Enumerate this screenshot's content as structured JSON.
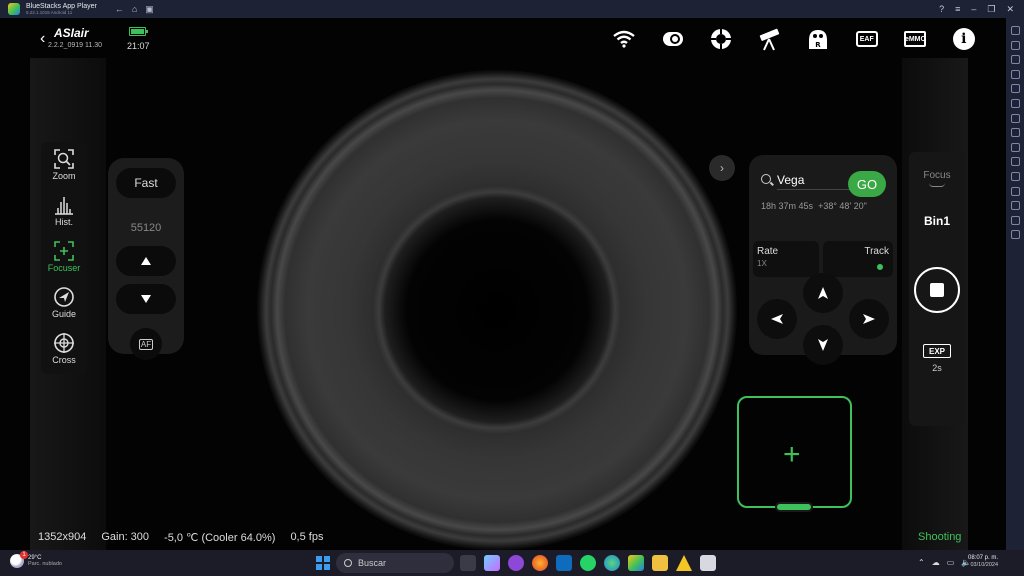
{
  "bluestacks": {
    "title": "BlueStacks App Player",
    "subtitle": "5.22.1.1015  Android 11"
  },
  "app": {
    "logo": "ASIair",
    "version": "2.2.2_0919 11.30",
    "time": "21:07",
    "top_icons": [
      "wifi-icon",
      "camera-icon",
      "guide-camera-icon",
      "telescope-icon",
      "rotator-icon",
      "eaf-icon",
      "emmc-icon",
      "info-icon"
    ],
    "top_icon_labels": {
      "eaf": "EAF",
      "emmc": "eMMC",
      "info": "i"
    }
  },
  "tools": [
    {
      "icon": "zoom-icon",
      "label": "Zoom"
    },
    {
      "icon": "histogram-icon",
      "label": "Hist."
    },
    {
      "icon": "focuser-icon",
      "label": "Focuser",
      "active": true
    },
    {
      "icon": "guide-icon",
      "label": "Guide"
    },
    {
      "icon": "crosshair-icon",
      "label": "Cross"
    }
  ],
  "focuser": {
    "speed": "Fast",
    "position": "55120",
    "af_label": "AF"
  },
  "mount": {
    "search_value": "Vega",
    "go_label": "GO",
    "ra": "18h 37m 45s",
    "dec": "+38° 48' 20\"",
    "rate_label": "Rate",
    "rate_value": "1X",
    "track_label": "Track",
    "tracking_on": true
  },
  "capture": {
    "focus_label": "Focus",
    "bin_label": "Bin1",
    "exp_label": "EXP",
    "exp_value": "2s"
  },
  "status": {
    "resolution": "1352x904",
    "gain": "Gain: 300",
    "temperature": "-5,0 ℃ (Cooler 64.0%)",
    "fps": "0,5 fps",
    "state": "Shooting"
  },
  "taskbar": {
    "weather_temp": "29°C",
    "weather_desc": "Parc. nublado",
    "weather_badge": "1",
    "search_placeholder": "Buscar",
    "time": "08:07 p. m.",
    "date": "03/10/2024"
  },
  "colors": {
    "accent_green": "#3ec15a",
    "go_green": "#3aa845",
    "taskbar": "#1c1c28",
    "bluestacks_chrome": "#1e2235"
  }
}
